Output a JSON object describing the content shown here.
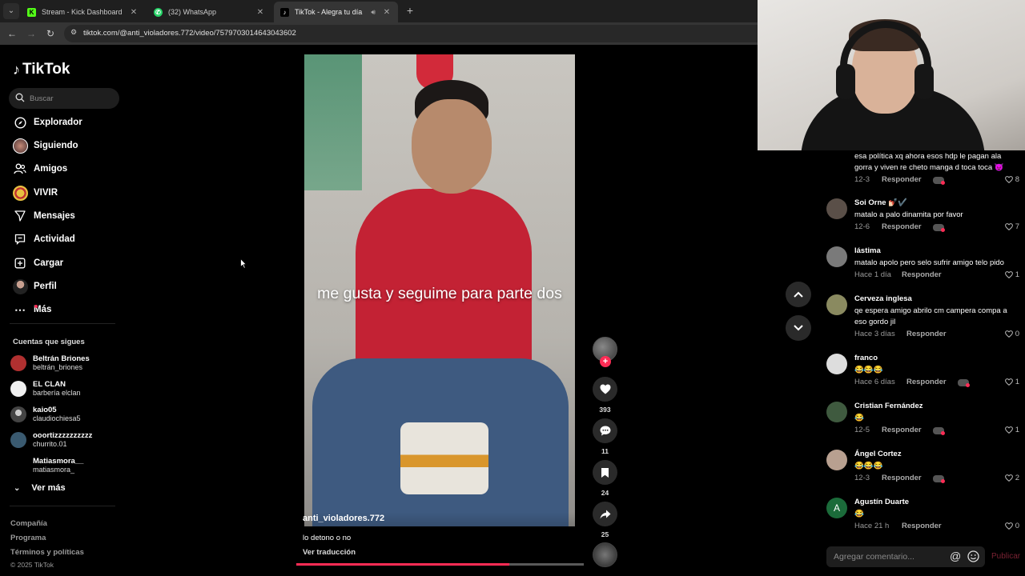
{
  "browser": {
    "tabs": [
      {
        "title": "Stream - Kick Dashboard",
        "favicon": "kick-icon",
        "color": "#53fc18",
        "active": false
      },
      {
        "title": "(32) WhatsApp",
        "favicon": "whatsapp-icon",
        "color": "#25d366",
        "active": false
      },
      {
        "title": "TikTok - Alegra tu día",
        "favicon": "tiktok-icon",
        "color": "#ffffff",
        "active": true
      }
    ],
    "url": "tiktok.com/@anti_violadores.772/video/7579703014643043602"
  },
  "sidebar": {
    "brand": "TikTok",
    "search_placeholder": "Buscar",
    "nav": [
      {
        "label": "Explorador",
        "icon": "compass-icon"
      },
      {
        "label": "Siguiendo",
        "icon": "avatar-icon"
      },
      {
        "label": "Amigos",
        "icon": "people-icon"
      },
      {
        "label": "VIVIR",
        "icon": "live-icon"
      },
      {
        "label": "Mensajes",
        "icon": "paper-plane-icon"
      },
      {
        "label": "Actividad",
        "icon": "message-box-icon"
      },
      {
        "label": "Cargar",
        "icon": "upload-plus-icon"
      },
      {
        "label": "Perfil",
        "icon": "profile-icon"
      },
      {
        "label": "Más",
        "icon": "more-dots-icon"
      }
    ],
    "following_title": "Cuentas que sigues",
    "following": [
      {
        "name": "Beltrán Briones",
        "username": "beltrán_briones",
        "color": "#b03030"
      },
      {
        "name": "EL CLAN",
        "username": "barbería elclan",
        "color": "#f0f0f0"
      },
      {
        "name": "kaio05",
        "username": "claudiochiesa5",
        "color": "#6a6a6a"
      },
      {
        "name": "ooortizzzzzzzzzz",
        "username": "churrito.01",
        "color": "#3a5a70"
      },
      {
        "name": "Matiasmora__",
        "username": "matiasmora_",
        "color": "#000000"
      }
    ],
    "see_more": "Ver más",
    "footer": [
      "Compañía",
      "Programa",
      "Términos y políticas"
    ],
    "copyright": "© 2025 TikTok"
  },
  "video": {
    "caption": "me gusta y seguime para parte dos",
    "username": "anti_violadores.772",
    "description": "lo detono o no",
    "translate": "Ver traducción",
    "progress": 0.74,
    "likes": "393",
    "comments": "11",
    "saves": "24",
    "shares": "25"
  },
  "comments": {
    "partial": {
      "text": "esa política xq ahora esos hdp le pagan ala gorra y viven re cheto manga d toca toca 😈",
      "date": "12-3",
      "reply": "Responder",
      "likes": "8"
    },
    "items": [
      {
        "name": "Soi Orne 💅🏻✔️",
        "text": "matalo a palo dinamita por favor",
        "date": "12-6",
        "reply": "Responder",
        "likes": "7",
        "creator": true,
        "avatar": "#5a4f48"
      },
      {
        "name": "lástima",
        "text": "matalo apolo pero selo sufrir amigo telo pido",
        "date": "Hace 1 día",
        "reply": "Responder",
        "likes": "1",
        "creator": false,
        "avatar": "#7a7a7a"
      },
      {
        "name": "Cerveza inglesa",
        "text": "qe espera amigo abrilo cm campera compa a eso gordo jil",
        "date": "Hace 3 días",
        "reply": "Responder",
        "likes": "0",
        "creator": false,
        "avatar": "#8a8a60"
      },
      {
        "name": "franco",
        "text": "😂😂😂",
        "date": "Hace 6 días",
        "reply": "Responder",
        "likes": "1",
        "creator": true,
        "avatar": "#dddddd"
      },
      {
        "name": "Cristian Fernández",
        "text": "😂",
        "date": "12-5",
        "reply": "Responder",
        "likes": "1",
        "creator": true,
        "avatar": "#3f5a3f"
      },
      {
        "name": "Ángel Cortez",
        "text": "😂😂😂",
        "date": "12-3",
        "reply": "Responder",
        "likes": "2",
        "creator": true,
        "avatar": "#b8a090"
      },
      {
        "name": "Agustín Duarte",
        "text": "😂",
        "date": "Hace 21 h",
        "reply": "Responder",
        "likes": "0",
        "creator": false,
        "avatar": "#1b6b3a",
        "initial": "A"
      }
    ],
    "input_placeholder": "Agregar comentario...",
    "publish": "Publicar"
  }
}
